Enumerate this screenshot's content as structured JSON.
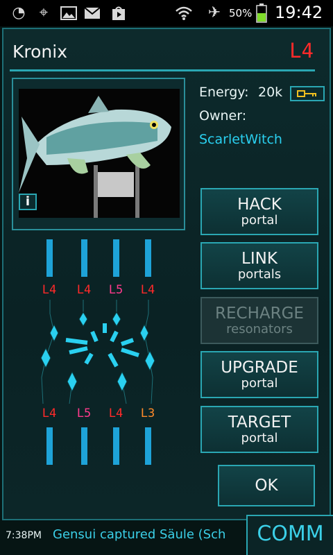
{
  "status_bar": {
    "battery_percent": "50%",
    "time": "19:42"
  },
  "portal": {
    "name": "Kronix",
    "level": "L4",
    "energy_label": "Energy:",
    "energy_value": "20k",
    "owner_label": "Owner:",
    "owner_name": "ScarletWitch",
    "info_label": "i"
  },
  "actions": [
    {
      "title": "HACK",
      "sub": "portal",
      "enabled": true
    },
    {
      "title": "LINK",
      "sub": "portals",
      "enabled": true
    },
    {
      "title": "RECHARGE",
      "sub": "resonators",
      "enabled": false
    },
    {
      "title": "UPGRADE",
      "sub": "portal",
      "enabled": true
    },
    {
      "title": "TARGET",
      "sub": "portal",
      "enabled": true
    }
  ],
  "ok_label": "OK",
  "resonators_top": [
    {
      "level": "L4",
      "color": "#ff2a2a"
    },
    {
      "level": "L4",
      "color": "#ff2a2a"
    },
    {
      "level": "L5",
      "color": "#ff3a8c"
    },
    {
      "level": "L4",
      "color": "#ff2a2a"
    }
  ],
  "resonators_bottom": [
    {
      "level": "L4",
      "color": "#ff2a2a"
    },
    {
      "level": "L5",
      "color": "#ff3a8c"
    },
    {
      "level": "L4",
      "color": "#ff2a2a"
    },
    {
      "level": "L3",
      "color": "#ff8a2a"
    }
  ],
  "comm": {
    "time": "7:38PM",
    "message": "Gensui captured Säule (Sch",
    "button_label": "COMM"
  },
  "colors": {
    "accent": "#2aa7b3",
    "portal_level": "#ff2a2a",
    "owner": "#2ad0f0",
    "resonator_bar": "#1ea3d8"
  }
}
